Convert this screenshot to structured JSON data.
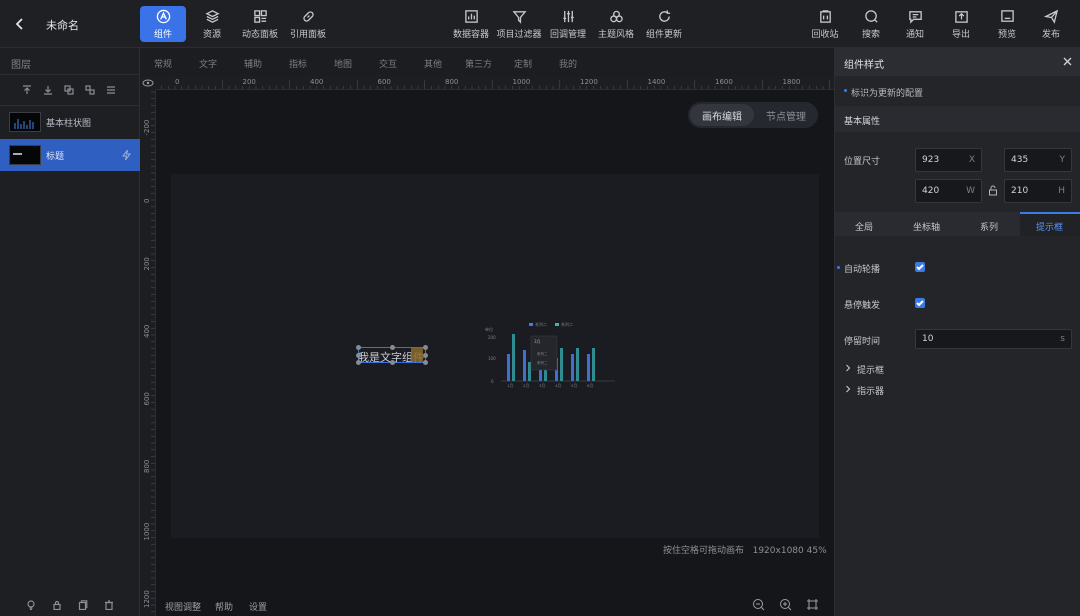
{
  "header": {
    "back_icon": "chevron-left-icon",
    "title": "未命名",
    "left_tools": [
      {
        "label": "组件",
        "icon": "component-icon",
        "active": true
      },
      {
        "label": "资源",
        "icon": "layers-icon"
      },
      {
        "label": "动态面板",
        "icon": "dashboard-icon"
      },
      {
        "label": "引用面板",
        "icon": "link-icon"
      }
    ],
    "center_tools": [
      {
        "label": "数据容器",
        "icon": "chart-box-icon"
      },
      {
        "label": "项目过滤器",
        "icon": "filter-icon"
      },
      {
        "label": "回调管理",
        "icon": "sliders-icon"
      },
      {
        "label": "主题风格",
        "icon": "theme-icon"
      },
      {
        "label": "组件更新",
        "icon": "refresh-icon"
      }
    ],
    "right_tools": [
      {
        "label": "回收站",
        "icon": "trash-icon"
      },
      {
        "label": "搜索",
        "icon": "search-icon"
      },
      {
        "label": "通知",
        "icon": "message-icon"
      },
      {
        "label": "导出",
        "icon": "export-icon"
      },
      {
        "label": "预览",
        "icon": "preview-icon"
      },
      {
        "label": "发布",
        "icon": "send-icon"
      }
    ]
  },
  "layers": {
    "title": "图层",
    "items": [
      {
        "label": "基本柱状图",
        "selected": false
      },
      {
        "label": "标题",
        "selected": true
      }
    ],
    "toolbar_icons": [
      "move-up-icon",
      "move-down-icon",
      "group-icon",
      "ungroup-icon",
      "list-icon"
    ],
    "footer_icons": [
      "bulb-icon",
      "lock-icon",
      "copy-icon",
      "delete-icon"
    ]
  },
  "component_tabs": [
    "常规",
    "文字",
    "辅助",
    "指标",
    "地图",
    "交互",
    "其他",
    "第三方",
    "定制",
    "我的"
  ],
  "ruler": {
    "h_labels": [
      "0",
      "200",
      "400",
      "600",
      "800",
      "1000",
      "1200",
      "1400",
      "1600",
      "1800"
    ],
    "v_labels": [
      "-200",
      "0",
      "200",
      "400",
      "600",
      "800",
      "1000",
      "1200"
    ]
  },
  "canvas": {
    "mode_tabs": [
      "画布编辑",
      "节点管理"
    ],
    "active_mode": "画布编辑",
    "text_component": "我是文字组件",
    "hint": "按住空格可拖动画布",
    "resolution": "1920x1080",
    "zoom": "45%"
  },
  "mini_chart": {
    "ylabel": "单位",
    "yticks": [
      "200",
      "100",
      "0"
    ],
    "legend": [
      "系列二",
      "系列二"
    ],
    "categories": [
      "1月",
      "2月",
      "3月",
      "4月",
      "5月",
      "6月"
    ],
    "tooltip_title": "3月",
    "tooltip_rows": [
      "系列二",
      "系列二"
    ]
  },
  "bottom_bar": {
    "links": [
      "视图调整",
      "帮助",
      "设置"
    ],
    "icons": [
      "zoom-out-icon",
      "zoom-in-icon",
      "fit-screen-icon"
    ]
  },
  "inspector": {
    "title": "组件样式",
    "note": "标识为更新的配置",
    "section": "基本属性",
    "pos_label": "位置尺寸",
    "x": "923",
    "x_suffix": "X",
    "y": "435",
    "y_suffix": "Y",
    "w": "420",
    "w_suffix": "W",
    "h": "210",
    "h_suffix": "H",
    "tabs": [
      "全局",
      "坐标轴",
      "系列",
      "提示框"
    ],
    "active_tab": "提示框",
    "auto_play_label": "自动轮播",
    "hover_label": "悬停触发",
    "duration_label": "停留时间",
    "duration_value": "10",
    "duration_unit": "s",
    "groups": [
      "提示框",
      "指示器"
    ],
    "accent": "#3a7be8"
  }
}
